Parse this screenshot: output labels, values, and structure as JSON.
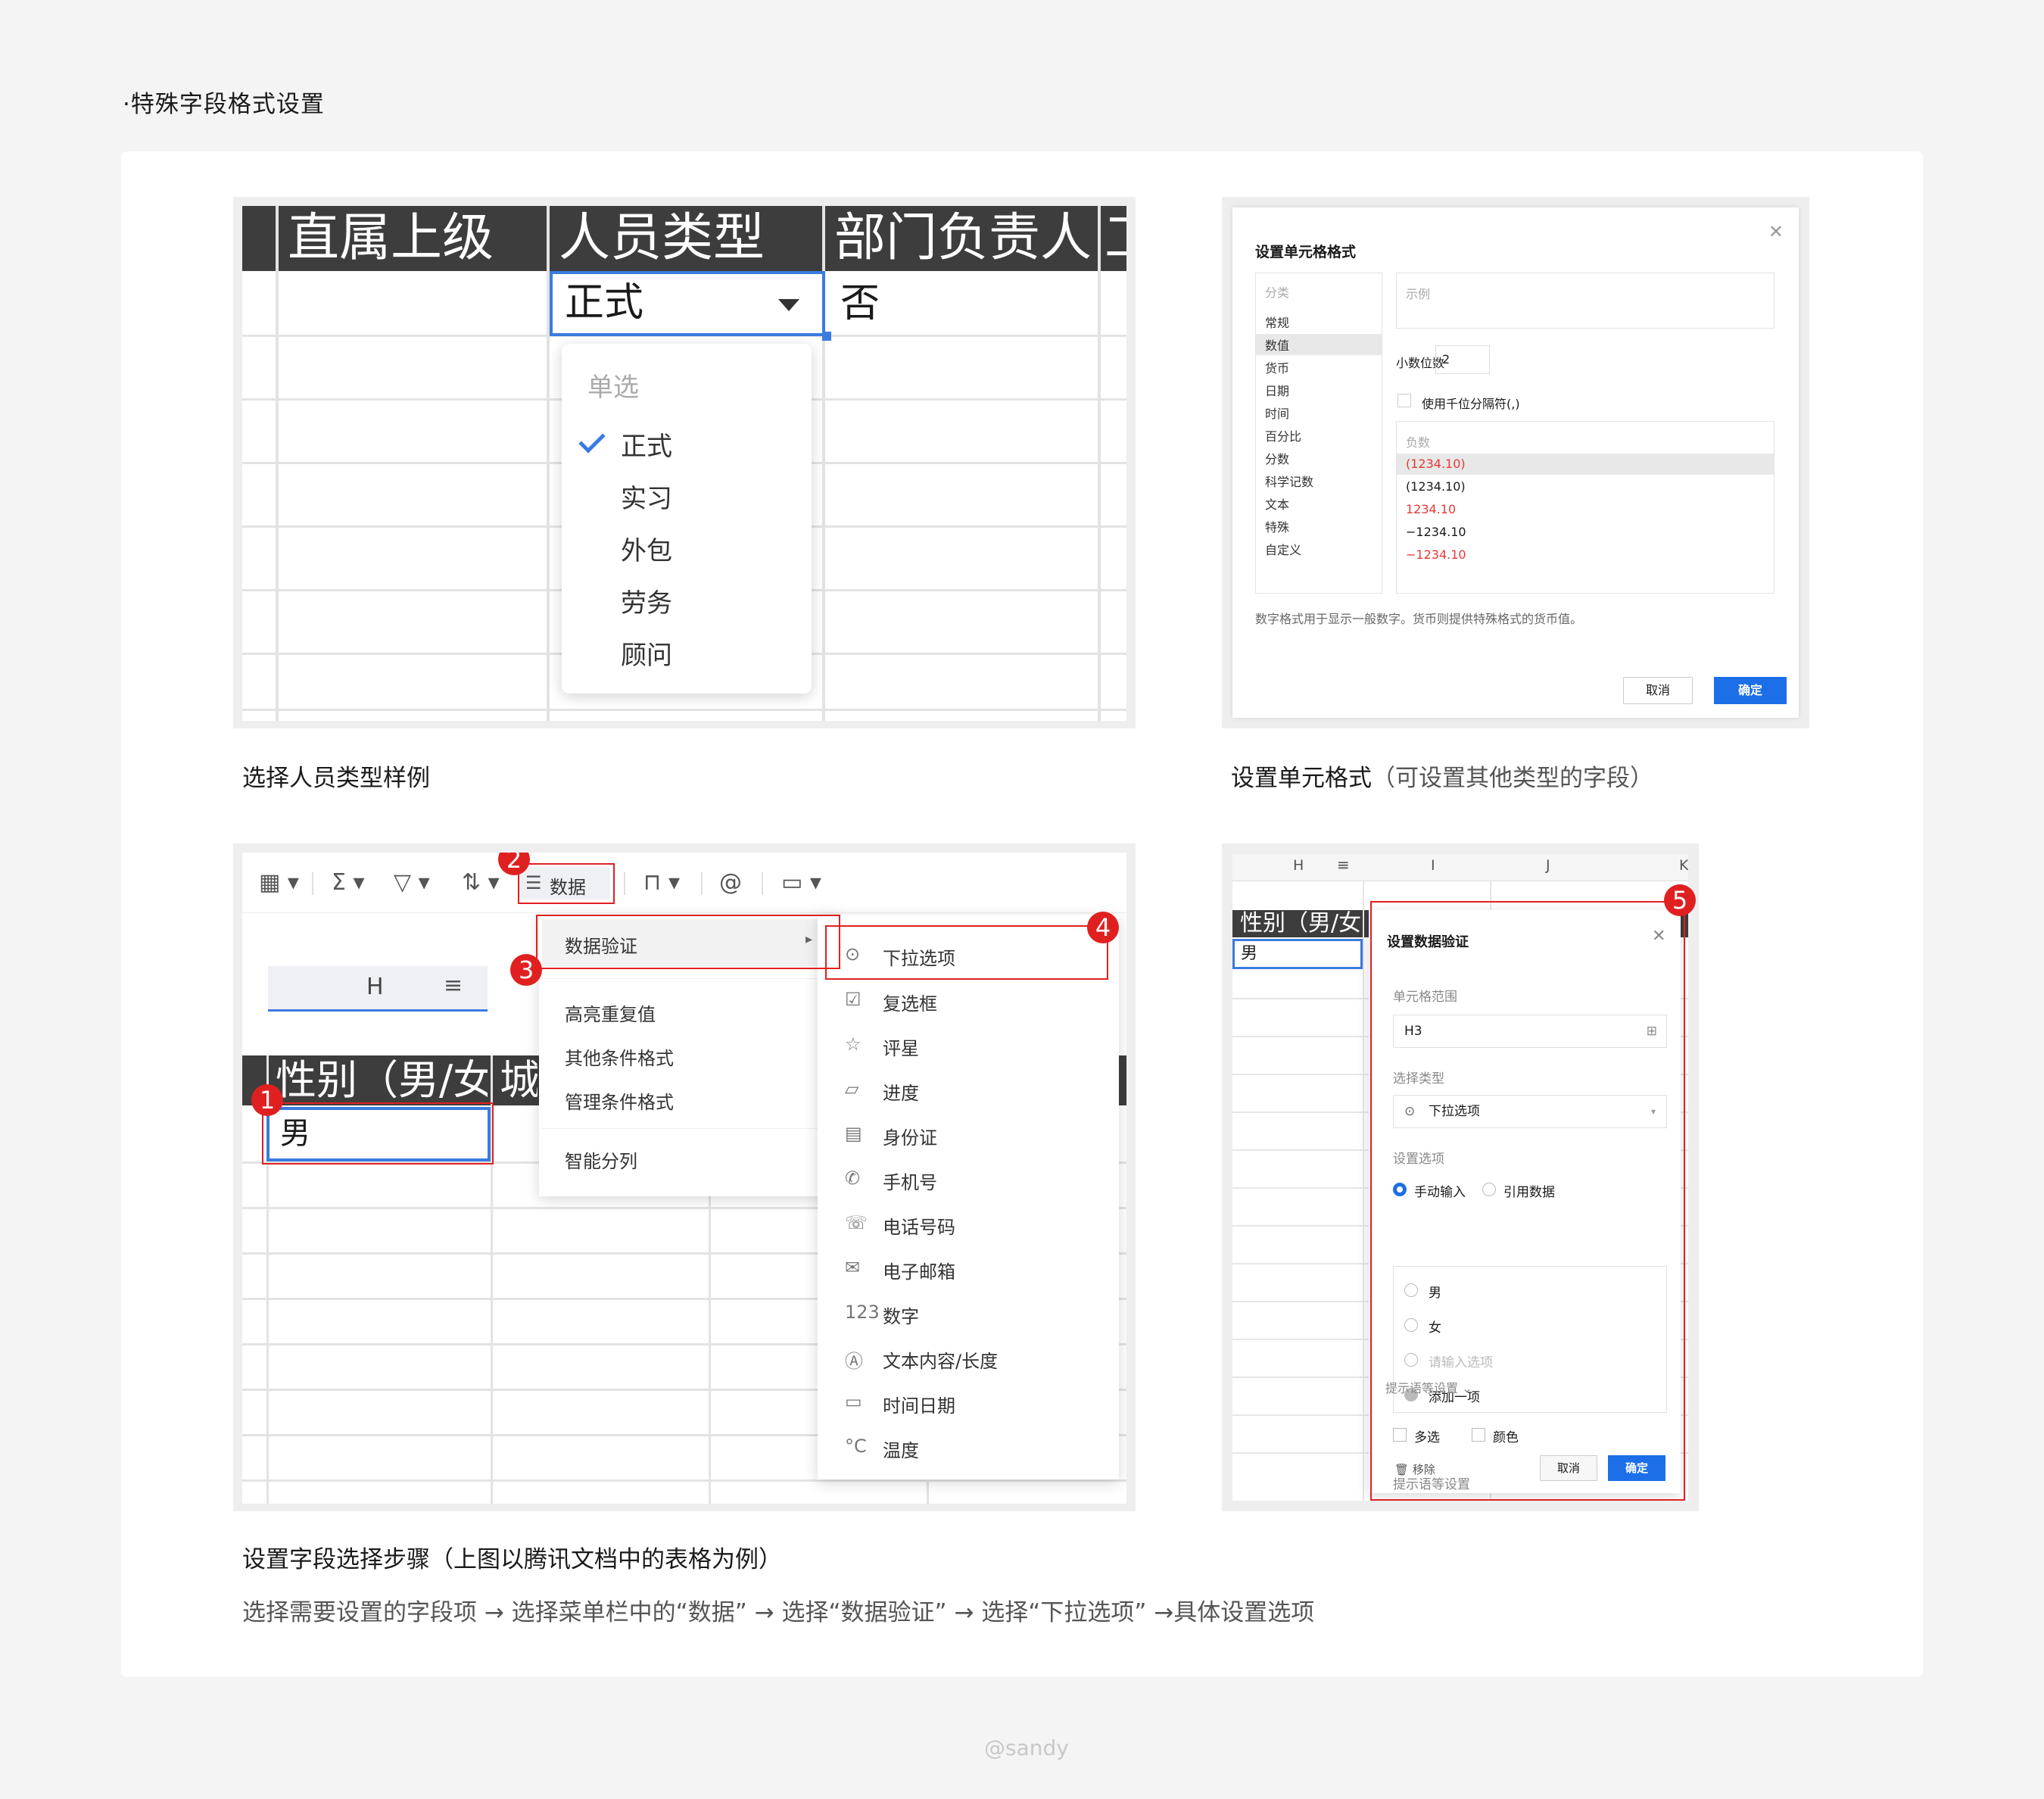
{
  "page_title": "·特殊字段格式设置",
  "watermark": "@sandy",
  "panel1": {
    "headers": [
      "直属上级",
      "人员类型",
      "部门负责人",
      "工"
    ],
    "selected_value": "正式",
    "neighbor_value": "否",
    "dropdown": {
      "group_label": "单选",
      "options": [
        "正式",
        "实习",
        "外包",
        "劳务",
        "顾问"
      ]
    },
    "caption": "选择人员类型样例"
  },
  "panel2": {
    "dialog_title": "设置单元格格式",
    "category_label": "分类",
    "categories": [
      "常规",
      "数值",
      "货币",
      "日期",
      "时间",
      "百分比",
      "分数",
      "科学记数",
      "文本",
      "特殊",
      "自定义"
    ],
    "example_label": "示例",
    "decimal_label": "小数位数",
    "decimal_value": "2",
    "thousand_sep_label": "使用千位分隔符(,)",
    "negative_label": "负数",
    "negatives": [
      "(1234.10)",
      "(1234.10)",
      "1234.10",
      "−1234.10",
      "−1234.10"
    ],
    "hint": "数字格式用于显示一般数字。货币则提供特殊格式的货币值。",
    "cancel": "取消",
    "ok": "确定",
    "caption_main": "设置单元格式",
    "caption_sub": "（可设置其他类型的字段）"
  },
  "panel3": {
    "toolbar_data_label": "数据",
    "column_header": "H",
    "data_header": "性别（男/女",
    "data_header_next": "城",
    "cell_value": "男",
    "menu1": [
      "数据验证",
      "高亮重复值",
      "其他条件格式",
      "管理条件格式",
      "智能分列"
    ],
    "menu2": [
      "下拉选项",
      "复选框",
      "评星",
      "进度",
      "身份证",
      "手机号",
      "电话号码",
      "电子邮箱",
      "数字",
      "文本内容/长度",
      "时间日期",
      "温度"
    ],
    "menu2_icons": [
      "⊙",
      "☑",
      "☆",
      "▱",
      "▤",
      "✆",
      "☏",
      "✉",
      "123",
      "Ⓐ",
      "▭",
      "°C"
    ],
    "badges": [
      "1",
      "2",
      "3",
      "4"
    ]
  },
  "panel4": {
    "columns": [
      "H",
      "I",
      "J",
      "K"
    ],
    "data_header": "性别（男/女",
    "cell_value": "男",
    "dialog_title": "设置数据验证",
    "range_label": "单元格范围",
    "range_value": "H3",
    "type_label": "选择类型",
    "type_value": "下拉选项",
    "options_label": "设置选项",
    "manual_input": "手动输入",
    "ref_data": "引用数据",
    "options": [
      "男",
      "女"
    ],
    "option_placeholder": "请输入选项",
    "add_option": "添加一项",
    "multi": "多选",
    "color": "颜色",
    "tip_setting": "提示语等设置",
    "remove": "移除",
    "cancel": "取消",
    "ok": "确定",
    "badge": "5"
  },
  "caption3_title": "设置字段选择步骤（上图以腾讯文档中的表格为例）",
  "caption3_desc": "选择需要设置的字段项 → 选择菜单栏中的“数据” → 选择“数据验证” → 选择“下拉选项” →具体设置选项"
}
